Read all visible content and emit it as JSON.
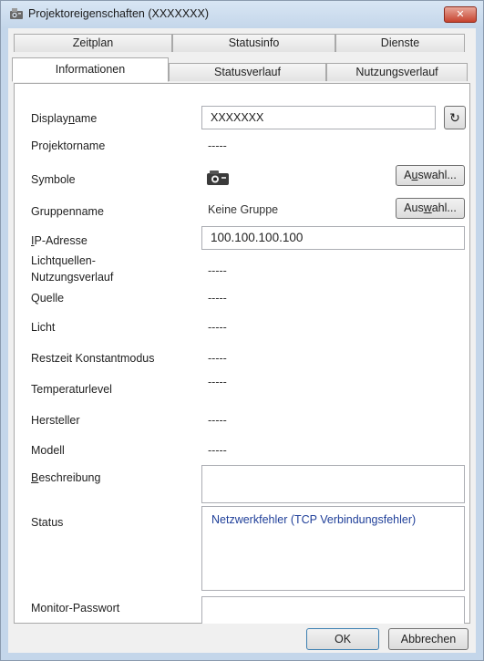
{
  "window": {
    "title": "Projektoreigenschaften (XXXXXXX)",
    "close_glyph": "✕"
  },
  "tabs": {
    "row_top": [
      "Zeitplan",
      "Statusinfo",
      "Dienste"
    ],
    "row_bottom": [
      "Informationen",
      "Statusverlauf",
      "Nutzungsverlauf"
    ],
    "active": "Informationen"
  },
  "form": {
    "displayname_label_pre": "Display",
    "displayname_label_mnemonic": "n",
    "displayname_label_post": "ame",
    "displayname_value": "XXXXXXX",
    "refresh_icon": "↻",
    "projektorname_label": "Projektorname",
    "projektorname_value": "-----",
    "symbole_label": "Symbole",
    "symbole_icon": "projector-icon",
    "symbole_button_pre": "A",
    "symbole_button_mnemonic": "u",
    "symbole_button_post": "swahl...",
    "gruppenname_label": "Gruppenname",
    "gruppenname_value": "Keine Gruppe",
    "gruppenname_button_pre": "Aus",
    "gruppenname_button_mnemonic": "w",
    "gruppenname_button_post": "ahl...",
    "ip_label_mnemonic": "I",
    "ip_label_post": "P-Adresse",
    "ip_value": "100.100.100.100",
    "lichtquellen_label_1": "Lichtquellen-",
    "lichtquellen_label_2": "Nutzungsverlauf",
    "lichtquellen_value": "-----",
    "quelle_label": "Quelle",
    "quelle_value": "-----",
    "licht_label": "Licht",
    "licht_value": "-----",
    "restzeit_label": "Restzeit Konstantmodus",
    "restzeit_value": "-----",
    "temperatur_label": "Temperaturlevel",
    "temperatur_value": "-----",
    "hersteller_label": "Hersteller",
    "hersteller_value": "-----",
    "modell_label": "Modell",
    "modell_value": "-----",
    "beschreibung_label_mnemonic": "B",
    "beschreibung_label_post": "eschreibung",
    "beschreibung_value": "",
    "status_label": "Status",
    "status_value": "Netzwerkfehler (TCP Verbindungsfehler)",
    "monitor_label": "Monitor-Passwort",
    "monitor_value": ""
  },
  "footer": {
    "ok_label": "OK",
    "cancel_label": "Abbrechen"
  }
}
